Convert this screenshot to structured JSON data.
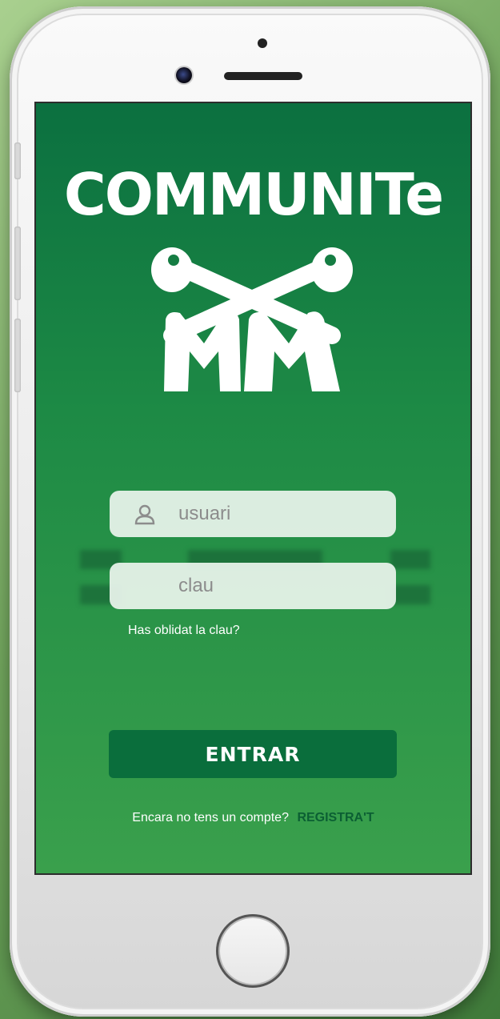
{
  "app": {
    "logo_text": "COMMUNITe"
  },
  "login": {
    "username_placeholder": "usuari",
    "password_placeholder": "clau",
    "forgot_label": "Has oblidat la clau?",
    "enter_label": "ENTRAR",
    "signup_prompt": "Encara no tens un compte?",
    "signup_link": "REGISTRA'T"
  },
  "icons": {
    "username": "user-icon",
    "logo": "crossed-bones-mm-icon"
  },
  "colors": {
    "screen_top": "#0b7040",
    "screen_bottom": "#3aa04c",
    "button": "#0a6e3c",
    "link": "#0b5f33"
  }
}
